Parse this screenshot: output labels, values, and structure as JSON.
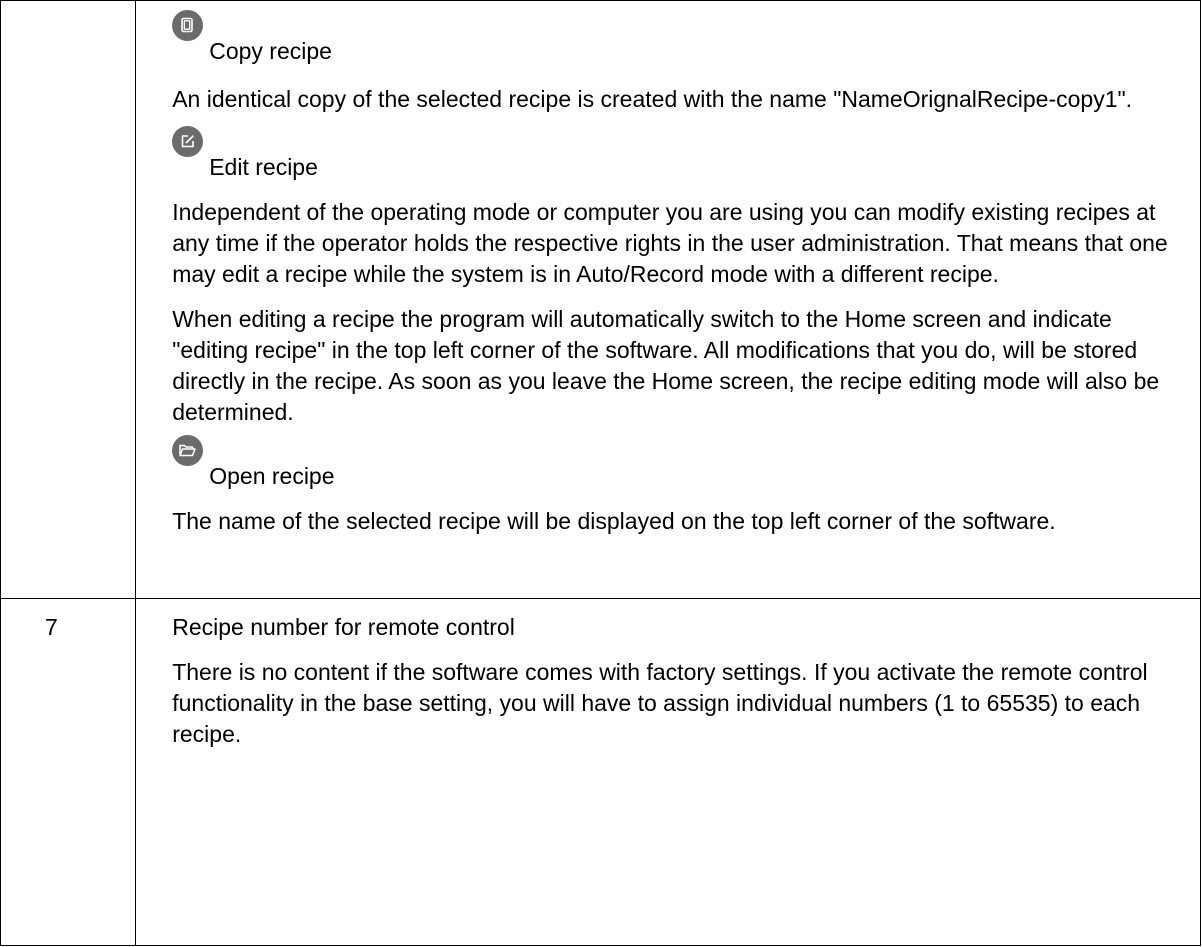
{
  "sections": {
    "copy": {
      "icon": "copy-icon",
      "title": "Copy recipe",
      "description": "An identical copy of the selected recipe is created with the name \"NameOrignalRecipe-copy1\"."
    },
    "edit": {
      "icon": "edit-icon",
      "title": "Edit recipe",
      "paragraphs": [
        "Independent of the operating mode or computer you are using you can modify existing recipes at any time if the operator holds the respective rights in the user administration. That means that one may edit a recipe while the system is in Auto/Record mode with a different recipe.",
        "When editing a recipe the program will automatically switch to the Home screen and indicate \"editing recipe\" in the top left corner of the software. All modifications that you do, will be stored directly in the recipe. As soon as you leave the Home screen, the recipe editing mode will also be determined."
      ]
    },
    "open": {
      "icon": "folder-open-icon",
      "title": "Open recipe",
      "description": "The name of the selected recipe will be displayed on the top left corner of the software."
    }
  },
  "row_7": {
    "number": "7",
    "title": "Recipe number for remote control",
    "description": "There is no content if the software comes with factory settings. If you activate the remote control functionality in the base setting, you will have to assign individual numbers (1 to 65535) to each recipe."
  },
  "colors": {
    "icon_background": "#6b6b6b",
    "icon_foreground": "#ffffff",
    "border": "#000000",
    "text": "#000000"
  }
}
